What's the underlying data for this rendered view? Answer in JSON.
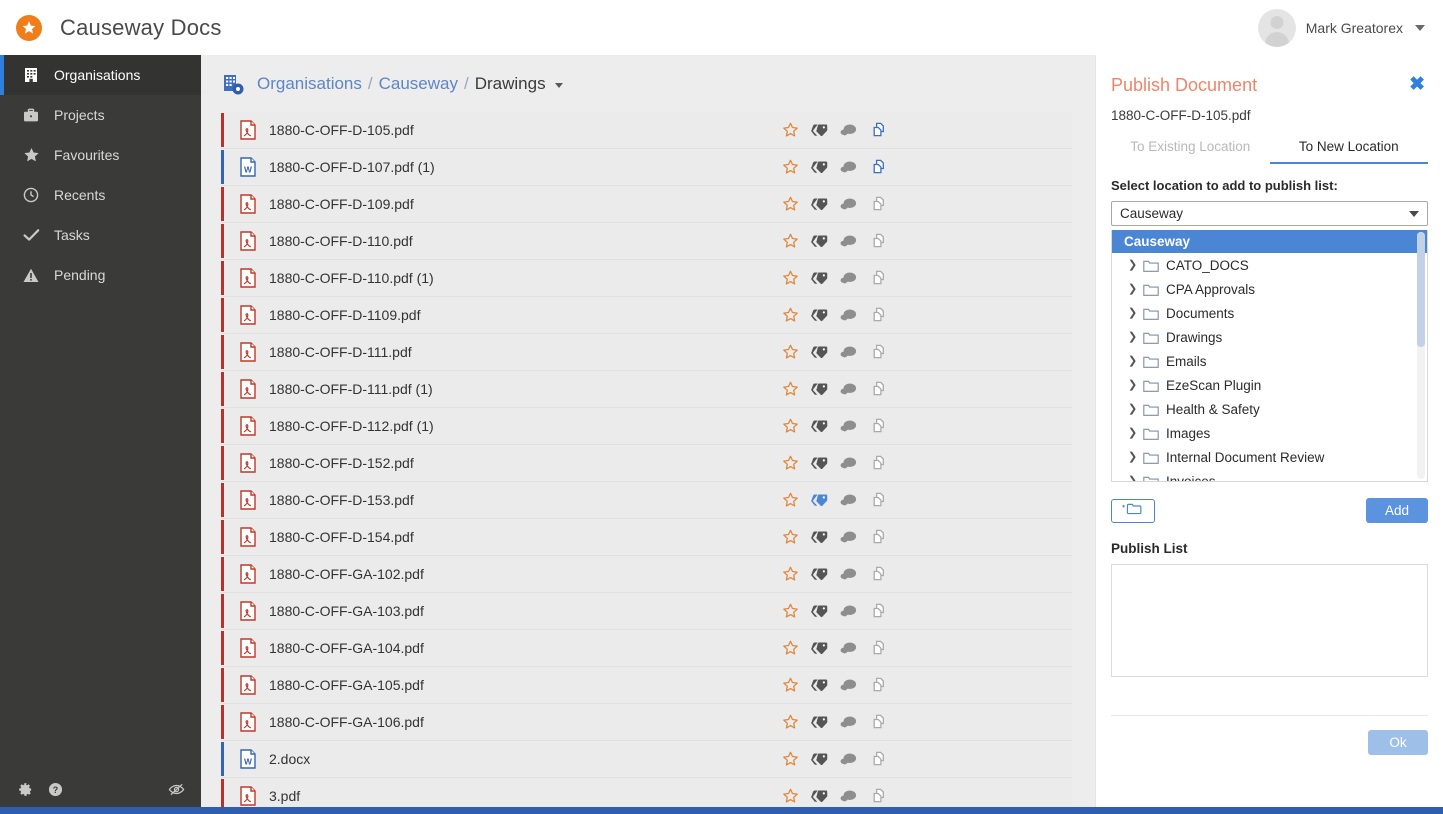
{
  "app": {
    "title": "Causeway Docs",
    "logo_icon": "star-burst-icon",
    "logo_color": "#f07d1a"
  },
  "user": {
    "name": "Mark Greatorex",
    "avatar_icon": "avatar-icon",
    "caret_icon": "chevron-down-icon"
  },
  "sidebar": {
    "items": [
      {
        "label": "Organisations",
        "icon": "building-icon",
        "active": true
      },
      {
        "label": "Projects",
        "icon": "briefcase-icon",
        "active": false
      },
      {
        "label": "Favourites",
        "icon": "star-icon",
        "active": false
      },
      {
        "label": "Recents",
        "icon": "clock-icon",
        "active": false
      },
      {
        "label": "Tasks",
        "icon": "check-icon",
        "active": false
      },
      {
        "label": "Pending",
        "icon": "warning-triangle-icon",
        "active": false
      }
    ],
    "footer": [
      {
        "icon": "gear-icon",
        "name": "settings-button"
      },
      {
        "icon": "help-circle-icon",
        "name": "help-button"
      },
      {
        "icon": "eye-slash-icon",
        "name": "visibility-toggle-button"
      }
    ],
    "active_accent": "#2f7fe0"
  },
  "breadcrumb": {
    "icon": "organisation-settings-icon",
    "items": [
      {
        "label": "Organisations",
        "link": true
      },
      {
        "label": "Causeway",
        "link": true
      },
      {
        "label": "Drawings",
        "link": false
      }
    ],
    "separator": "/",
    "caret_icon": "chevron-down-icon"
  },
  "file_list": {
    "actions": [
      "favourite-star-icon",
      "tag-icon",
      "comment-icon",
      "publish-copy-icon"
    ],
    "rows": [
      {
        "name": "1880-C-OFF-D-105.pdf",
        "type": "pdf",
        "star": "off",
        "tag": "dark",
        "comment": "on",
        "publish": "blue"
      },
      {
        "name": "1880-C-OFF-D-107.pdf (1)",
        "type": "doc",
        "star": "off",
        "tag": "dark",
        "comment": "on",
        "publish": "blue"
      },
      {
        "name": "1880-C-OFF-D-109.pdf",
        "type": "pdf",
        "star": "off",
        "tag": "dark",
        "comment": "on",
        "publish": "grey"
      },
      {
        "name": "1880-C-OFF-D-110.pdf",
        "type": "pdf",
        "star": "off",
        "tag": "dark",
        "comment": "on",
        "publish": "grey"
      },
      {
        "name": "1880-C-OFF-D-110.pdf (1)",
        "type": "pdf",
        "star": "off",
        "tag": "dark",
        "comment": "on",
        "publish": "grey"
      },
      {
        "name": "1880-C-OFF-D-1109.pdf",
        "type": "pdf",
        "star": "off",
        "tag": "dark",
        "comment": "on",
        "publish": "grey"
      },
      {
        "name": "1880-C-OFF-D-111.pdf",
        "type": "pdf",
        "star": "off",
        "tag": "dark",
        "comment": "on",
        "publish": "grey"
      },
      {
        "name": "1880-C-OFF-D-111.pdf (1)",
        "type": "pdf",
        "star": "off",
        "tag": "dark",
        "comment": "on",
        "publish": "grey"
      },
      {
        "name": "1880-C-OFF-D-112.pdf (1)",
        "type": "pdf",
        "star": "off",
        "tag": "dark",
        "comment": "on",
        "publish": "grey"
      },
      {
        "name": "1880-C-OFF-D-152.pdf",
        "type": "pdf",
        "star": "off",
        "tag": "dark",
        "comment": "on",
        "publish": "grey"
      },
      {
        "name": "1880-C-OFF-D-153.pdf",
        "type": "pdf",
        "star": "off",
        "tag": "blue",
        "comment": "on",
        "publish": "grey"
      },
      {
        "name": "1880-C-OFF-D-154.pdf",
        "type": "pdf",
        "star": "off",
        "tag": "dark",
        "comment": "on",
        "publish": "grey"
      },
      {
        "name": "1880-C-OFF-GA-102.pdf",
        "type": "pdf",
        "star": "off",
        "tag": "dark",
        "comment": "on",
        "publish": "grey"
      },
      {
        "name": "1880-C-OFF-GA-103.pdf",
        "type": "pdf",
        "star": "off",
        "tag": "dark",
        "comment": "on",
        "publish": "grey"
      },
      {
        "name": "1880-C-OFF-GA-104.pdf",
        "type": "pdf",
        "star": "off",
        "tag": "dark",
        "comment": "on",
        "publish": "grey"
      },
      {
        "name": "1880-C-OFF-GA-105.pdf",
        "type": "pdf",
        "star": "off",
        "tag": "dark",
        "comment": "on",
        "publish": "grey"
      },
      {
        "name": "1880-C-OFF-GA-106.pdf",
        "type": "pdf",
        "star": "off",
        "tag": "dark",
        "comment": "on",
        "publish": "grey"
      },
      {
        "name": "2.docx",
        "type": "doc",
        "star": "off",
        "tag": "dark",
        "comment": "on",
        "publish": "grey"
      },
      {
        "name": "3.pdf",
        "type": "pdf",
        "star": "off",
        "tag": "dark",
        "comment": "on",
        "publish": "grey"
      }
    ]
  },
  "panel": {
    "title": "Publish Document",
    "close_icon": "close-icon",
    "file_name": "1880-C-OFF-D-105.pdf",
    "tabs": [
      {
        "label": "To Existing Location",
        "active": false
      },
      {
        "label": "To New Location",
        "active": true
      }
    ],
    "select_label": "Select location to add to publish list:",
    "select_value": "Causeway",
    "select_caret_icon": "chevron-down-icon",
    "tree": {
      "root": "Causeway",
      "items": [
        {
          "label": "CATO_DOCS"
        },
        {
          "label": "CPA Approvals"
        },
        {
          "label": "Documents"
        },
        {
          "label": "Drawings"
        },
        {
          "label": "Emails"
        },
        {
          "label": "EzeScan Plugin"
        },
        {
          "label": "Health & Safety"
        },
        {
          "label": "Images"
        },
        {
          "label": "Internal Document Review"
        },
        {
          "label": "Invoices"
        }
      ],
      "expand_icon": "chevron-right-icon",
      "folder_icon": "folder-icon"
    },
    "new_folder_icon": "new-folder-icon",
    "add_label": "Add",
    "publish_list_label": "Publish List",
    "ok_label": "Ok",
    "accent": "#4a86d4",
    "title_color": "#f0846b"
  }
}
